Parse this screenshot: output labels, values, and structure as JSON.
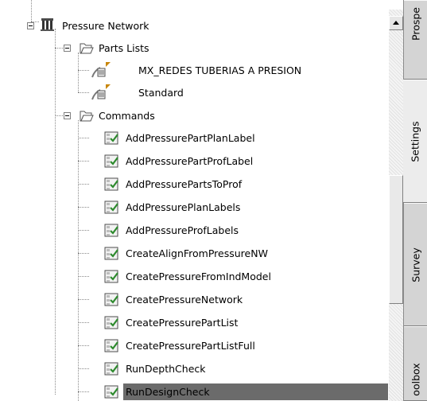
{
  "tree": {
    "root": {
      "label": "Pressure Network",
      "icon": "pressure-network-icon"
    },
    "parts_lists": {
      "label": "Parts Lists",
      "icon": "folder-open-icon",
      "items": [
        {
          "label": "MX_REDES TUBERIAS A PRESION",
          "icon": "parts-list-icon"
        },
        {
          "label": "Standard",
          "icon": "parts-list-icon"
        }
      ]
    },
    "commands": {
      "label": "Commands",
      "icon": "folder-open-icon",
      "items": [
        {
          "label": "AddPressurePartPlanLabel"
        },
        {
          "label": "AddPressurePartProfLabel"
        },
        {
          "label": "AddPressurePartsToProf"
        },
        {
          "label": "AddPressurePlanLabels"
        },
        {
          "label": "AddPressureProfLabels"
        },
        {
          "label": "CreateAlignFromPressureNW"
        },
        {
          "label": "CreatePressureFromIndModel"
        },
        {
          "label": "CreatePressureNetwork"
        },
        {
          "label": "CreatePressurePartList"
        },
        {
          "label": "CreatePressurePartListFull"
        },
        {
          "label": "RunDepthCheck"
        },
        {
          "label": "RunDesignCheck",
          "selected": true
        }
      ]
    }
  },
  "side_tabs": [
    {
      "label": "Prospe"
    },
    {
      "label": "Settings",
      "active": true
    },
    {
      "label": "Survey"
    },
    {
      "label": "oolbox"
    }
  ],
  "colors": {
    "selection": "#6b6b6b",
    "command_icon": "#2d8a2d"
  }
}
